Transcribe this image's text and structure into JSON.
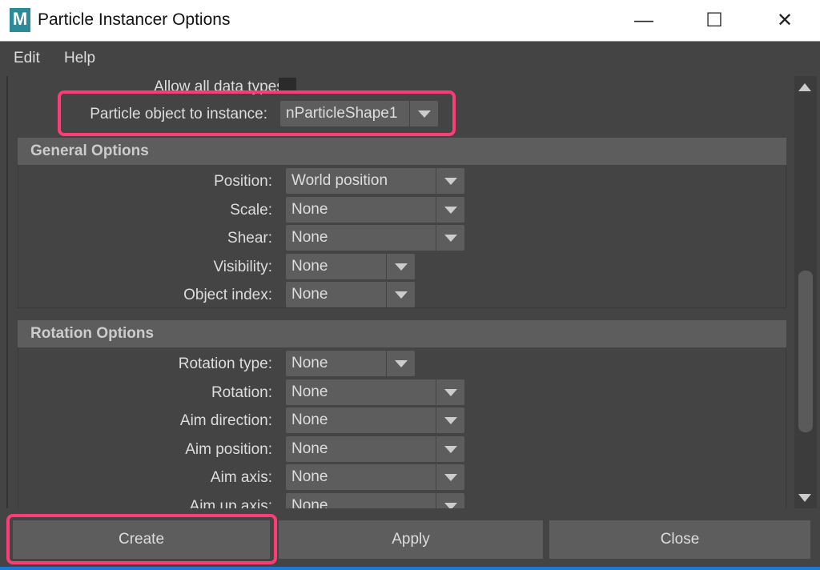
{
  "window": {
    "title": "Particle Instancer Options",
    "logo_text": "M",
    "controls": [
      "minimize",
      "maximize",
      "close"
    ]
  },
  "menu": [
    "Edit",
    "Help"
  ],
  "top": {
    "allow_all_label": "Allow all data types:",
    "particle_label": "Particle object to instance:",
    "particle_value": "nParticleShape1"
  },
  "general": {
    "title": "General Options",
    "rows": [
      {
        "label": "Position:",
        "value": "World position"
      },
      {
        "label": "Scale:",
        "value": "None"
      },
      {
        "label": "Shear:",
        "value": "None"
      },
      {
        "label": "Visibility:",
        "value": "None"
      },
      {
        "label": "Object index:",
        "value": "None"
      }
    ]
  },
  "rotation": {
    "title": "Rotation Options",
    "rows": [
      {
        "label": "Rotation type:",
        "value": "None"
      },
      {
        "label": "Rotation:",
        "value": "None"
      },
      {
        "label": "Aim direction:",
        "value": "None"
      },
      {
        "label": "Aim position:",
        "value": "None"
      },
      {
        "label": "Aim axis:",
        "value": "None"
      },
      {
        "label": "Aim up axis:",
        "value": "None"
      }
    ]
  },
  "buttons": {
    "create": "Create",
    "apply": "Apply",
    "close": "Close"
  },
  "highlight_color": "#ff3c74"
}
